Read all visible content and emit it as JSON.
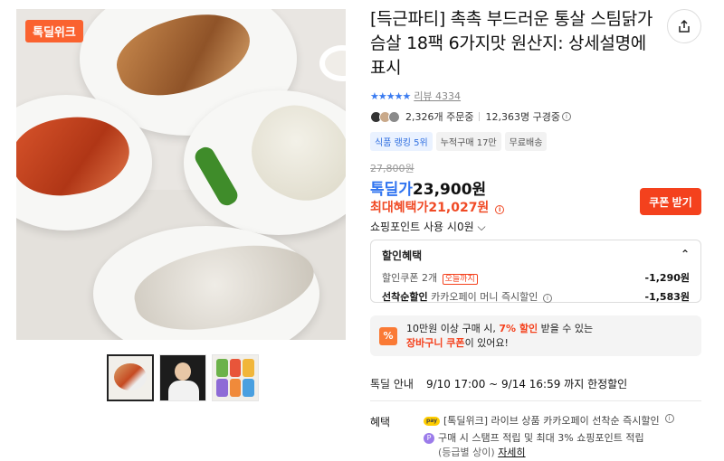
{
  "product": {
    "title": "[득근파티] 촉촉 부드러운 통살 스팀닭가슴살 18팩 6가지맛 원산지: 상세설명에 표시",
    "badge": "톡딜위크",
    "stars": "★★★★★",
    "review_label": "리뷰 4334"
  },
  "social": {
    "orders": "2,326개 주문중",
    "subscribers": "12,363명 구경중"
  },
  "chips": [
    "식품 랭킹 5위",
    "누적구매 17만",
    "무료배송"
  ],
  "price": {
    "original": "27,800원",
    "deal_label": "톡딜가",
    "deal_price": "23,900원",
    "best_label": "최대혜택가",
    "best_price": "21,027원",
    "coupon_button": "쿠폰 받기",
    "points_label": "쇼핑포인트 사용 시0원",
    "points_chevron": "⌵"
  },
  "discounts": {
    "header": "할인혜택",
    "chevron": "⌃",
    "coupon_label": "할인쿠폰 2개",
    "coupon_tag": "오늘까지",
    "coupon_amount": "-1,290원",
    "first_label": "선착순할인",
    "first_desc": "카카오페이 머니 즉시할인",
    "first_amount": "-1,583원"
  },
  "promo": {
    "icon": "%",
    "line1_pre": "10만원 이상 구매 시, ",
    "line1_hl": "7% 할인",
    "line1_post": " 받을 수 있는",
    "line2_hl": "장바구니 쿠폰",
    "line2_post": "이 있어요!"
  },
  "deal_info": {
    "label": "톡딜 안내",
    "value": "9/10 17:00 ~ 9/14 16:59 까지 한정할인"
  },
  "benefits": {
    "label": "혜택",
    "item1": "[톡딜위크] 라이브 상품 카카오페이 선착순 즉시할인",
    "item2_line1": "구매 시 스탬프 적립 및 최대 3% 쇼핑포인트 적립",
    "item2_line2": "(등급별 상이)",
    "detail_link": "자세히",
    "pay_icon": "pay",
    "p_icon": "P"
  },
  "icons": {
    "share": "share-icon",
    "info": "i"
  },
  "colors": {
    "accent_red": "#f4411d",
    "deal_blue": "#3074f0",
    "badge_orange": "#fa622f"
  }
}
